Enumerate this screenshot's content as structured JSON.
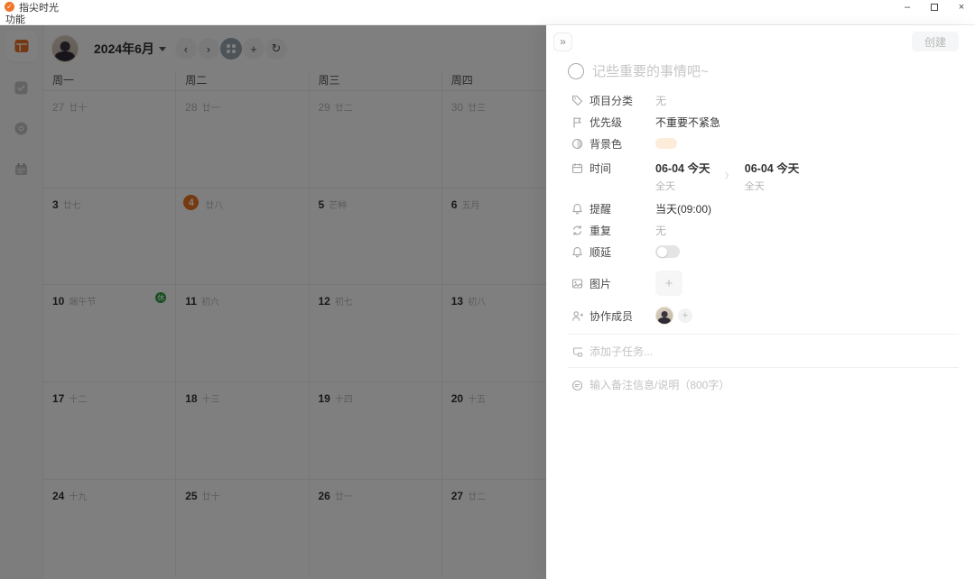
{
  "window": {
    "app_title": "指尖时光",
    "check_glyph": "✓",
    "menu_items": [
      {
        "label": "功能"
      }
    ],
    "controls": {
      "minimize": "–",
      "close": "×"
    }
  },
  "toolbar": {
    "month_label": "2024年6月",
    "icons": {
      "prev": "‹",
      "next": "›",
      "add": "+",
      "refresh": "↻"
    }
  },
  "sidebar": {
    "items": [
      {
        "icon": "calendar-view-icon",
        "active": true
      },
      {
        "icon": "tasks-check-icon",
        "active": false
      },
      {
        "icon": "focus-disc-icon",
        "active": false
      },
      {
        "icon": "schedule-icon",
        "active": false
      }
    ]
  },
  "calendar": {
    "day_headers": [
      "周一",
      "周二",
      "周三",
      "周四"
    ],
    "rest_badge": "休",
    "weeks": [
      [
        {
          "day": "27",
          "lunar": "廿十",
          "muted": true
        },
        {
          "day": "28",
          "lunar": "廿一",
          "muted": true
        },
        {
          "day": "29",
          "lunar": "廿二",
          "muted": true
        },
        {
          "day": "30",
          "lunar": "廿三",
          "muted": true
        }
      ],
      [
        {
          "day": "3",
          "lunar": "廿七"
        },
        {
          "day": "4",
          "lunar": "廿八",
          "today": true
        },
        {
          "day": "5",
          "lunar": "芒种"
        },
        {
          "day": "6",
          "lunar": "五月"
        }
      ],
      [
        {
          "day": "10",
          "lunar": "端午节",
          "rest": true
        },
        {
          "day": "11",
          "lunar": "初六"
        },
        {
          "day": "12",
          "lunar": "初七"
        },
        {
          "day": "13",
          "lunar": "初八"
        }
      ],
      [
        {
          "day": "17",
          "lunar": "十二"
        },
        {
          "day": "18",
          "lunar": "十三"
        },
        {
          "day": "19",
          "lunar": "十四"
        },
        {
          "day": "20",
          "lunar": "十五"
        }
      ],
      [
        {
          "day": "24",
          "lunar": "十九"
        },
        {
          "day": "25",
          "lunar": "廿十"
        },
        {
          "day": "26",
          "lunar": "廿一"
        },
        {
          "day": "27",
          "lunar": "廿二"
        }
      ]
    ]
  },
  "panel": {
    "collapse_icon": "»",
    "create_label": "创建",
    "title_placeholder": "记些重要的事情吧~",
    "fields": {
      "category": {
        "label": "项目分类",
        "value": "无"
      },
      "priority": {
        "label": "优先级",
        "value": "不重要不紧急"
      },
      "background_color": {
        "label": "背景色",
        "swatch": "#fcecd9"
      },
      "time": {
        "label": "时间",
        "separator": "›",
        "start_date": "06-04 今天",
        "start_detail": "全天",
        "end_date": "06-04 今天",
        "end_detail": "全天"
      },
      "reminder": {
        "label": "提醒",
        "value": "当天(09:00)"
      },
      "repeat": {
        "label": "重复",
        "value": "无"
      },
      "postpone": {
        "label": "顺延",
        "toggle_state": "off"
      },
      "image": {
        "label": "图片",
        "add_icon": "+"
      },
      "members": {
        "label": "协作成员",
        "add_icon": "+"
      }
    },
    "subtask_placeholder": "添加子任务...",
    "note_placeholder": "输入备注信息/说明（800字）"
  },
  "colors": {
    "accent": "#ee7420",
    "holiday_green": "#2f9e44",
    "bg_swatch": "#fcecd9",
    "scrim": "rgba(0,0,0,0.5)"
  }
}
